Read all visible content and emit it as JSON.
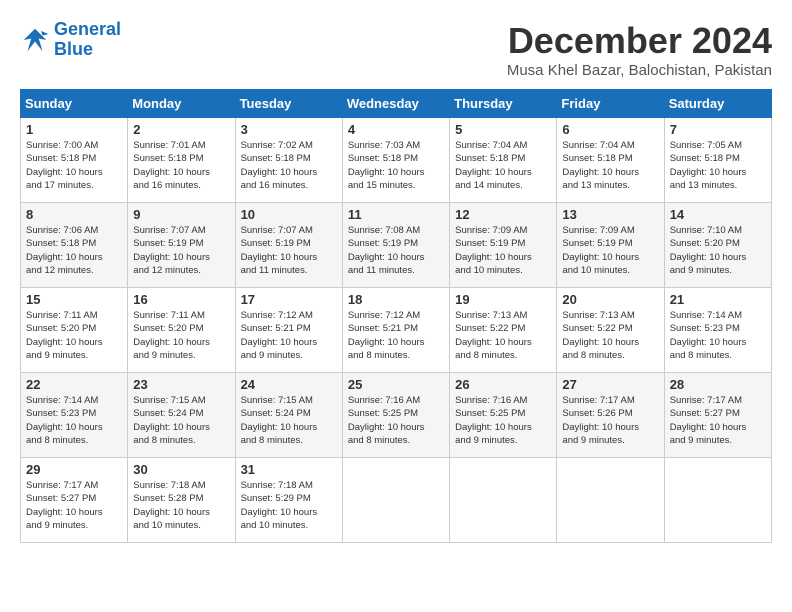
{
  "logo": {
    "text1": "General",
    "text2": "Blue"
  },
  "header": {
    "title": "December 2024",
    "location": "Musa Khel Bazar, Balochistan, Pakistan"
  },
  "weekdays": [
    "Sunday",
    "Monday",
    "Tuesday",
    "Wednesday",
    "Thursday",
    "Friday",
    "Saturday"
  ],
  "weeks": [
    [
      {
        "day": "1",
        "info": "Sunrise: 7:00 AM\nSunset: 5:18 PM\nDaylight: 10 hours\nand 17 minutes."
      },
      {
        "day": "2",
        "info": "Sunrise: 7:01 AM\nSunset: 5:18 PM\nDaylight: 10 hours\nand 16 minutes."
      },
      {
        "day": "3",
        "info": "Sunrise: 7:02 AM\nSunset: 5:18 PM\nDaylight: 10 hours\nand 16 minutes."
      },
      {
        "day": "4",
        "info": "Sunrise: 7:03 AM\nSunset: 5:18 PM\nDaylight: 10 hours\nand 15 minutes."
      },
      {
        "day": "5",
        "info": "Sunrise: 7:04 AM\nSunset: 5:18 PM\nDaylight: 10 hours\nand 14 minutes."
      },
      {
        "day": "6",
        "info": "Sunrise: 7:04 AM\nSunset: 5:18 PM\nDaylight: 10 hours\nand 13 minutes."
      },
      {
        "day": "7",
        "info": "Sunrise: 7:05 AM\nSunset: 5:18 PM\nDaylight: 10 hours\nand 13 minutes."
      }
    ],
    [
      {
        "day": "8",
        "info": "Sunrise: 7:06 AM\nSunset: 5:18 PM\nDaylight: 10 hours\nand 12 minutes."
      },
      {
        "day": "9",
        "info": "Sunrise: 7:07 AM\nSunset: 5:19 PM\nDaylight: 10 hours\nand 12 minutes."
      },
      {
        "day": "10",
        "info": "Sunrise: 7:07 AM\nSunset: 5:19 PM\nDaylight: 10 hours\nand 11 minutes."
      },
      {
        "day": "11",
        "info": "Sunrise: 7:08 AM\nSunset: 5:19 PM\nDaylight: 10 hours\nand 11 minutes."
      },
      {
        "day": "12",
        "info": "Sunrise: 7:09 AM\nSunset: 5:19 PM\nDaylight: 10 hours\nand 10 minutes."
      },
      {
        "day": "13",
        "info": "Sunrise: 7:09 AM\nSunset: 5:19 PM\nDaylight: 10 hours\nand 10 minutes."
      },
      {
        "day": "14",
        "info": "Sunrise: 7:10 AM\nSunset: 5:20 PM\nDaylight: 10 hours\nand 9 minutes."
      }
    ],
    [
      {
        "day": "15",
        "info": "Sunrise: 7:11 AM\nSunset: 5:20 PM\nDaylight: 10 hours\nand 9 minutes."
      },
      {
        "day": "16",
        "info": "Sunrise: 7:11 AM\nSunset: 5:20 PM\nDaylight: 10 hours\nand 9 minutes."
      },
      {
        "day": "17",
        "info": "Sunrise: 7:12 AM\nSunset: 5:21 PM\nDaylight: 10 hours\nand 9 minutes."
      },
      {
        "day": "18",
        "info": "Sunrise: 7:12 AM\nSunset: 5:21 PM\nDaylight: 10 hours\nand 8 minutes."
      },
      {
        "day": "19",
        "info": "Sunrise: 7:13 AM\nSunset: 5:22 PM\nDaylight: 10 hours\nand 8 minutes."
      },
      {
        "day": "20",
        "info": "Sunrise: 7:13 AM\nSunset: 5:22 PM\nDaylight: 10 hours\nand 8 minutes."
      },
      {
        "day": "21",
        "info": "Sunrise: 7:14 AM\nSunset: 5:23 PM\nDaylight: 10 hours\nand 8 minutes."
      }
    ],
    [
      {
        "day": "22",
        "info": "Sunrise: 7:14 AM\nSunset: 5:23 PM\nDaylight: 10 hours\nand 8 minutes."
      },
      {
        "day": "23",
        "info": "Sunrise: 7:15 AM\nSunset: 5:24 PM\nDaylight: 10 hours\nand 8 minutes."
      },
      {
        "day": "24",
        "info": "Sunrise: 7:15 AM\nSunset: 5:24 PM\nDaylight: 10 hours\nand 8 minutes."
      },
      {
        "day": "25",
        "info": "Sunrise: 7:16 AM\nSunset: 5:25 PM\nDaylight: 10 hours\nand 8 minutes."
      },
      {
        "day": "26",
        "info": "Sunrise: 7:16 AM\nSunset: 5:25 PM\nDaylight: 10 hours\nand 9 minutes."
      },
      {
        "day": "27",
        "info": "Sunrise: 7:17 AM\nSunset: 5:26 PM\nDaylight: 10 hours\nand 9 minutes."
      },
      {
        "day": "28",
        "info": "Sunrise: 7:17 AM\nSunset: 5:27 PM\nDaylight: 10 hours\nand 9 minutes."
      }
    ],
    [
      {
        "day": "29",
        "info": "Sunrise: 7:17 AM\nSunset: 5:27 PM\nDaylight: 10 hours\nand 9 minutes."
      },
      {
        "day": "30",
        "info": "Sunrise: 7:18 AM\nSunset: 5:28 PM\nDaylight: 10 hours\nand 10 minutes."
      },
      {
        "day": "31",
        "info": "Sunrise: 7:18 AM\nSunset: 5:29 PM\nDaylight: 10 hours\nand 10 minutes."
      },
      null,
      null,
      null,
      null
    ]
  ]
}
